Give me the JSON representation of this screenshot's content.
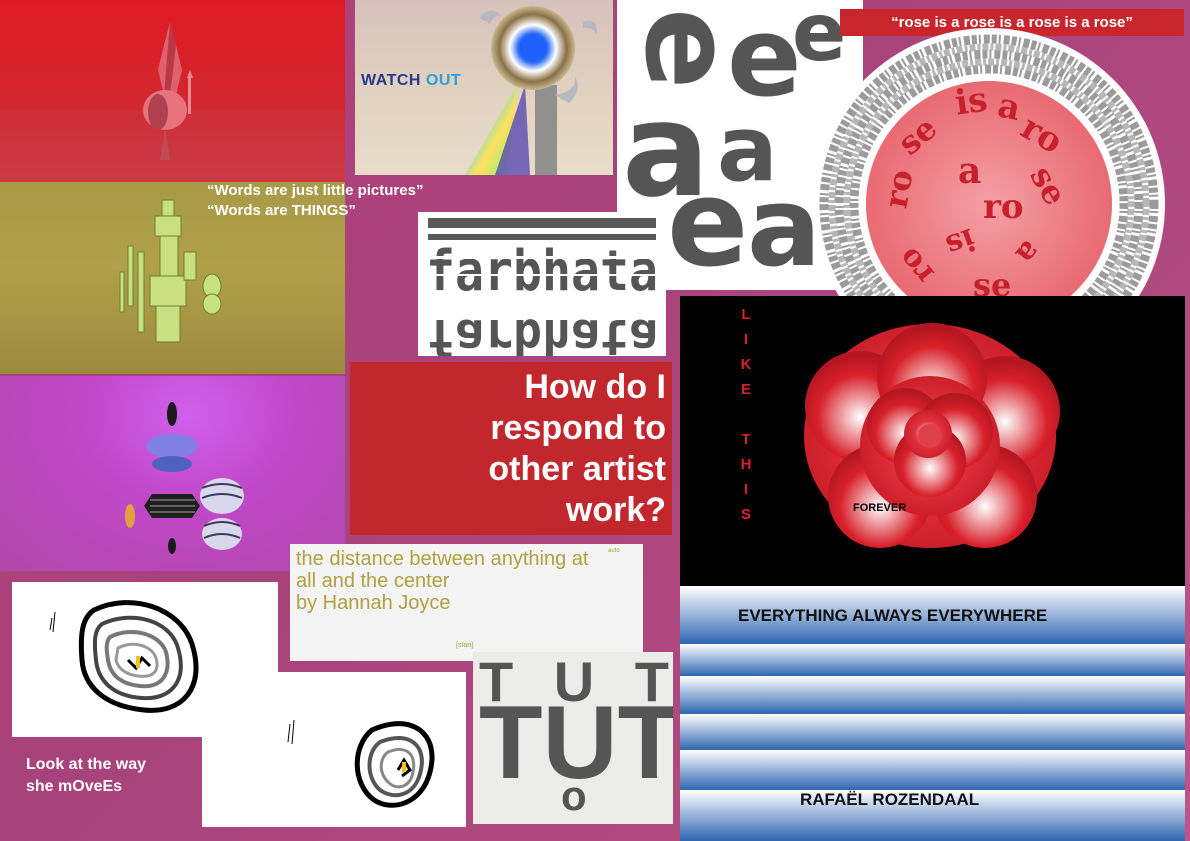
{
  "quotes": {
    "line1": "“Words are just little pictures”",
    "line2": "“Words are THINGS”"
  },
  "watch_out": {
    "word1": "WATCH",
    "word2": "OUT"
  },
  "question": {
    "line1": "How do I",
    "line2": "respond to",
    "line3": "other artist",
    "line4": "work?"
  },
  "rose_quote": "“rose is a rose is a rose is a rose”",
  "rose_spiral_text": "isarose",
  "rose_circle_words": "DAS GESCHEHEN FALLS DANN VOR SICH STRAMBUSTRIG DEN AUSWEIS OBSEHNE FREIHEIT WORT MAL UND ZU ES WANN ES MIR WIE DAS SCHWINDEN SIE",
  "like_this": {
    "letters_like": [
      "L",
      "I",
      "K",
      "E"
    ],
    "letters_this": [
      "T",
      "H",
      "I",
      "S"
    ]
  },
  "forever": "FOREVER",
  "everything": "EVERYTHING ALWAYS EVERYWHERE",
  "artist": "RAFAËL ROZENDAAL",
  "distance": {
    "line1": "the distance between anything at",
    "line2": "all and the center",
    "line3": "by Hannah Joyce",
    "note": "auto",
    "start": "[start]"
  },
  "moves": {
    "line1": "Look at the way",
    "line2": "she mOveEs"
  },
  "tut": {
    "row1": [
      "T",
      "U",
      "T"
    ],
    "row2": [
      "T",
      "U",
      "T"
    ],
    "dot": "o"
  },
  "colors": {
    "background": "#b04a7e",
    "red_panel": "#c2272d",
    "rose_red": "#d8202a",
    "blue_panel": "#3a78c0",
    "gray_type": "#555555",
    "hannah_text": "#b0a040"
  }
}
